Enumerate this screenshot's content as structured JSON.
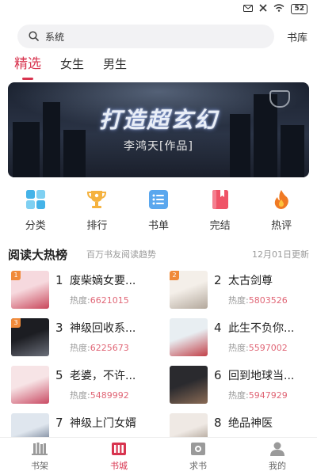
{
  "status": {
    "battery": "52"
  },
  "search": {
    "text": "系统",
    "library_label": "书库"
  },
  "tabs": [
    {
      "label": "精选",
      "active": true
    },
    {
      "label": "女生",
      "active": false
    },
    {
      "label": "男生",
      "active": false
    }
  ],
  "banner": {
    "title": "打造超玄幻",
    "author": "李鸿天[作品]"
  },
  "quick_nav": [
    {
      "label": "分类",
      "icon": "grid-icon",
      "color": "#45b3e8"
    },
    {
      "label": "排行",
      "icon": "trophy-icon",
      "color": "#f5b23e"
    },
    {
      "label": "书单",
      "icon": "list-icon",
      "color": "#5aa7ee"
    },
    {
      "label": "完结",
      "icon": "book-icon",
      "color": "#ef5367"
    },
    {
      "label": "热评",
      "icon": "flame-icon",
      "color": "#f07a24"
    }
  ],
  "ranking": {
    "title": "阅读大热榜",
    "subtitle": "百万书友阅读趋势",
    "date": "12月01日更新",
    "heat_label": "热度:",
    "items": [
      {
        "rank": "1",
        "name": "废柴嫡女要...",
        "heat": "6621015",
        "badge": "1",
        "badge_color": "#f08a3a",
        "cover_colors": [
          "#f6d9de",
          "#c9475b"
        ]
      },
      {
        "rank": "2",
        "name": "太古剑尊",
        "heat": "5803526",
        "badge": "2",
        "badge_color": "#f08a3a",
        "cover_colors": [
          "#f4efe9",
          "#b3a89c"
        ]
      },
      {
        "rank": "3",
        "name": "神级回收系...",
        "heat": "6225673",
        "badge": "3",
        "badge_color": "#f08a3a",
        "cover_colors": [
          "#1c1d22",
          "#6b6f7a"
        ]
      },
      {
        "rank": "4",
        "name": "此生不负你...",
        "heat": "5597002",
        "badge": "",
        "badge_color": "",
        "cover_colors": [
          "#e8eef2",
          "#c24048"
        ]
      },
      {
        "rank": "5",
        "name": "老婆，不许...",
        "heat": "5489992",
        "badge": "",
        "badge_color": "",
        "cover_colors": [
          "#f7e4e6",
          "#c94a63"
        ]
      },
      {
        "rank": "6",
        "name": "回到地球当...",
        "heat": "5947929",
        "badge": "",
        "badge_color": "",
        "cover_colors": [
          "#2a2a2e",
          "#8a6b55"
        ]
      },
      {
        "rank": "7",
        "name": "神级上门女婿",
        "heat": "",
        "badge": "",
        "badge_color": "",
        "cover_colors": [
          "#dfe6ee",
          "#3a4a66"
        ]
      },
      {
        "rank": "8",
        "name": "绝品神医",
        "heat": "",
        "badge": "",
        "badge_color": "",
        "cover_colors": [
          "#efe9e4",
          "#8a7a6a"
        ]
      }
    ]
  },
  "bottom_nav": [
    {
      "label": "书架",
      "icon": "bookshelf-icon",
      "active": false
    },
    {
      "label": "书城",
      "icon": "bookstore-icon",
      "active": true
    },
    {
      "label": "求书",
      "icon": "request-book-icon",
      "active": false
    },
    {
      "label": "我的",
      "icon": "profile-icon",
      "active": false
    }
  ],
  "colors": {
    "accent": "#d8344f",
    "heat": "#e06676"
  }
}
